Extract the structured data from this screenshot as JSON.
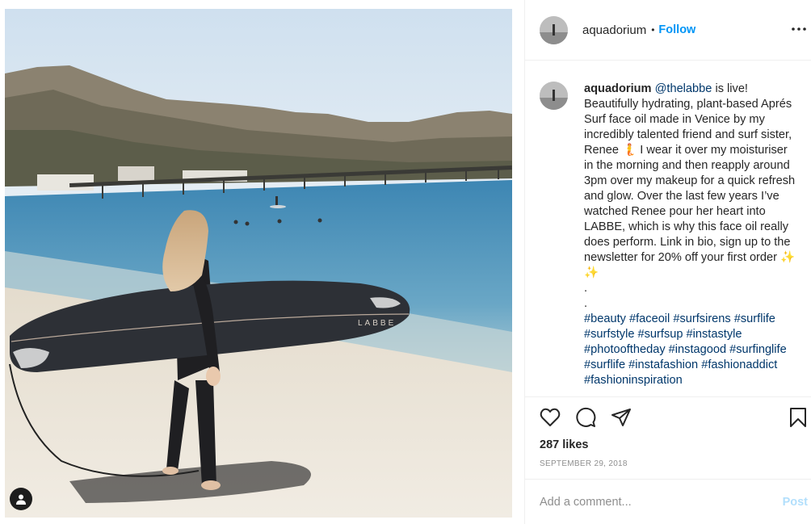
{
  "post": {
    "username": "aquadorium",
    "follow_label": "Follow",
    "separator": "•",
    "caption": {
      "author": "aquadorium",
      "mention": "@thelabbe",
      "body": " is live! Beautifully hydrating, plant-based Aprés Surf face oil made in Venice by my incredibly talented friend and surf sister, Renee 🧜 I wear it over my moisturiser in the morning and then reapply around 3pm over my makeup for a quick refresh and glow. Over the last few years I’ve watched Renee pour her heart into LABBE, which is why this face oil really does perform. Link in bio, sign up to the newsletter for 20% off your first order ✨ ✨",
      "dot1": ".",
      "dot2": ".",
      "hashtags": "#beauty #faceoil #surfsirens #surflife #surfstyle #surfsup #instastyle #photooftheday #instagood #surfinglife #surflife #instafashion #fashionaddict #fashioninspiration"
    },
    "likes": "287 likes",
    "date": "SEPTEMBER 29, 2018",
    "comment": {
      "placeholder": "Add a comment...",
      "value": "",
      "post_label": "Post"
    },
    "board_text": "LABBE",
    "icons": {
      "more": "more-options-icon",
      "like": "heart-icon",
      "comment": "comment-icon",
      "share": "share-icon",
      "save": "bookmark-icon",
      "tag": "user-tag-icon"
    },
    "colors": {
      "link": "#0095f6",
      "hashtag": "#00376b",
      "muted": "#8e8e8e",
      "post_disabled": "#b2dffc"
    }
  }
}
